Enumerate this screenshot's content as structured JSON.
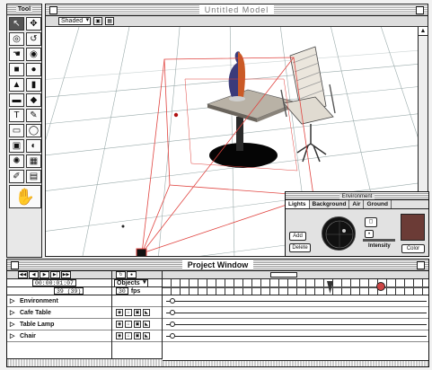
{
  "toolbox": {
    "title": "Tool",
    "tools": [
      {
        "name": "select-tool",
        "glyph": "↖",
        "selected": true
      },
      {
        "name": "rotate-tool",
        "glyph": "✥"
      },
      {
        "name": "sphere-rotate-tool",
        "glyph": "◎"
      },
      {
        "name": "camera-orbit-tool",
        "glyph": "↺"
      },
      {
        "name": "hand-tool",
        "glyph": "☚"
      },
      {
        "name": "eye-tool",
        "glyph": "◉"
      },
      {
        "name": "cube-tool",
        "glyph": "■"
      },
      {
        "name": "sphere-tool",
        "glyph": "●"
      },
      {
        "name": "cone-tool",
        "glyph": "▲"
      },
      {
        "name": "cylinder-tool",
        "glyph": "▮"
      },
      {
        "name": "box-tool",
        "glyph": "▬"
      },
      {
        "name": "pyramid-tool",
        "glyph": "◆"
      },
      {
        "name": "text-tool",
        "glyph": "T"
      },
      {
        "name": "eyedropper-tool",
        "glyph": "✎"
      },
      {
        "name": "lathe-tool",
        "glyph": "▭"
      },
      {
        "name": "torus-tool",
        "glyph": "◯"
      },
      {
        "name": "extrude-tool",
        "glyph": "▣"
      },
      {
        "name": "deform-tool",
        "glyph": "◐"
      },
      {
        "name": "light-tool",
        "glyph": "✺"
      },
      {
        "name": "paint-tool",
        "glyph": "▦"
      },
      {
        "name": "paintbrush-tool",
        "glyph": "✐"
      },
      {
        "name": "texture-tool",
        "glyph": "▤"
      }
    ],
    "big_tool": {
      "name": "render-tool",
      "glyph": "✋"
    }
  },
  "model_window": {
    "title": "Untitled Model",
    "render_mode": "Shaded"
  },
  "environment": {
    "title": "Environment",
    "tabs": [
      "Lights",
      "Background",
      "Air",
      "Ground"
    ],
    "active_tab": "Lights",
    "add_label": "Add",
    "delete_label": "Delete",
    "intensity_label": "Intensity",
    "color_label": "Color",
    "swatch_color": "#6b3b36"
  },
  "project_window": {
    "title": "Project Window",
    "timecode": "00:00:01:07",
    "frame": "39 (39)",
    "objects_label": "Objects",
    "fps_value": "30",
    "fps_unit": "fps",
    "rows": [
      {
        "label": "Environment"
      },
      {
        "label": "Cafe Table"
      },
      {
        "label": "Table Lamp"
      },
      {
        "label": "Chair"
      }
    ]
  }
}
